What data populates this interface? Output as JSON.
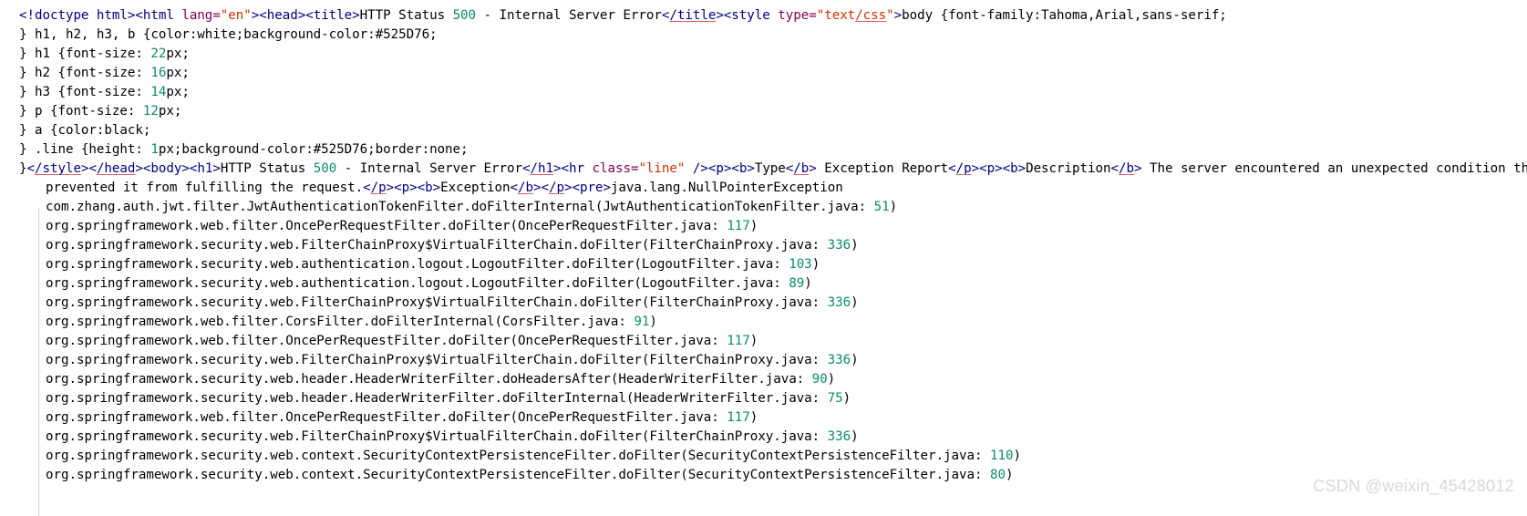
{
  "editor": {
    "language": "html",
    "colors": {
      "background": "#ffffff",
      "foreground": "#000000",
      "tag": "#000080",
      "attribute_name": "#7F0055",
      "attribute_value": "#CC3300",
      "number": "#0E8A6E",
      "indent_guide": "#CFCFCF",
      "spellcheck_underline": "#D06060",
      "watermark": "#D8D8D8"
    },
    "lines": [
      {
        "id": "line-1",
        "indent": 0,
        "tokens": [
          {
            "t": "tag",
            "v": "<!doctype html><html "
          },
          {
            "t": "attr",
            "v": "lang="
          },
          {
            "t": "attrval",
            "v": "\"en\""
          },
          {
            "t": "tag",
            "v": "><head><title>"
          },
          {
            "t": "plain",
            "v": "HTTP Status "
          },
          {
            "t": "num",
            "v": "500"
          },
          {
            "t": "plain",
            "v": " - Internal Server Error"
          },
          {
            "t": "tag",
            "v": "<",
            "u": false
          },
          {
            "t": "tag-u",
            "v": "/title"
          },
          {
            "t": "tag",
            "v": "><style "
          },
          {
            "t": "attr",
            "v": "type="
          },
          {
            "t": "attrval",
            "v": "\"text"
          },
          {
            "t": "attrval-u",
            "v": "/css"
          },
          {
            "t": "attrval",
            "v": "\""
          },
          {
            "t": "tag",
            "v": ">"
          },
          {
            "t": "plain",
            "v": "body {font-family:Tahoma,Arial,sans-serif;"
          }
        ]
      },
      {
        "id": "line-2",
        "indent": 0,
        "tokens": [
          {
            "t": "plain",
            "v": "} h1, h2, h3, b {color:white;background-color:#525D76;"
          }
        ]
      },
      {
        "id": "line-3",
        "indent": 0,
        "tokens": [
          {
            "t": "plain",
            "v": "} h1 {font-size: "
          },
          {
            "t": "num",
            "v": "22"
          },
          {
            "t": "plain",
            "v": "px;"
          }
        ]
      },
      {
        "id": "line-4",
        "indent": 0,
        "tokens": [
          {
            "t": "plain",
            "v": "} h2 {font-size: "
          },
          {
            "t": "num",
            "v": "16"
          },
          {
            "t": "plain",
            "v": "px;"
          }
        ]
      },
      {
        "id": "line-5",
        "indent": 0,
        "tokens": [
          {
            "t": "plain",
            "v": "} h3 {font-size: "
          },
          {
            "t": "num",
            "v": "14"
          },
          {
            "t": "plain",
            "v": "px;"
          }
        ]
      },
      {
        "id": "line-6",
        "indent": 0,
        "tokens": [
          {
            "t": "plain",
            "v": "} p {font-size: "
          },
          {
            "t": "num",
            "v": "12"
          },
          {
            "t": "plain",
            "v": "px;"
          }
        ]
      },
      {
        "id": "line-7",
        "indent": 0,
        "tokens": [
          {
            "t": "plain",
            "v": "} a {color:black;"
          }
        ]
      },
      {
        "id": "line-8",
        "indent": 0,
        "tokens": [
          {
            "t": "plain",
            "v": "} .line {height: "
          },
          {
            "t": "num",
            "v": "1"
          },
          {
            "t": "plain",
            "v": "px;background-color:#525D76;border:none;"
          }
        ]
      },
      {
        "id": "line-9",
        "indent": 0,
        "tokens": [
          {
            "t": "plain",
            "v": "}"
          },
          {
            "t": "tag",
            "v": "<"
          },
          {
            "t": "tag-u",
            "v": "/style"
          },
          {
            "t": "tag",
            "v": "><"
          },
          {
            "t": "tag-u",
            "v": "/head"
          },
          {
            "t": "tag",
            "v": "><body><h1>"
          },
          {
            "t": "plain",
            "v": "HTTP Status "
          },
          {
            "t": "num",
            "v": "500"
          },
          {
            "t": "plain",
            "v": " - Internal Server Error"
          },
          {
            "t": "tag",
            "v": "<"
          },
          {
            "t": "tag-u",
            "v": "/h1"
          },
          {
            "t": "tag",
            "v": "><hr "
          },
          {
            "t": "attr",
            "v": "class="
          },
          {
            "t": "attrval",
            "v": "\"line\""
          },
          {
            "t": "tag",
            "v": " /><p><b>"
          },
          {
            "t": "plain",
            "v": "Type"
          },
          {
            "t": "tag",
            "v": "<"
          },
          {
            "t": "tag-u",
            "v": "/b"
          },
          {
            "t": "tag",
            "v": ">"
          },
          {
            "t": "plain",
            "v": " Exception Report"
          },
          {
            "t": "tag",
            "v": "<"
          },
          {
            "t": "tag-u",
            "v": "/p"
          },
          {
            "t": "tag",
            "v": "><p><b>"
          },
          {
            "t": "plain",
            "v": "Description"
          },
          {
            "t": "tag",
            "v": "<"
          },
          {
            "t": "tag-u",
            "v": "/b"
          },
          {
            "t": "tag",
            "v": ">"
          },
          {
            "t": "plain",
            "v": " The server encountered an unexpected condition that"
          }
        ]
      },
      {
        "id": "line-10",
        "indent": 1,
        "tokens": [
          {
            "t": "plain",
            "v": "prevented it from fulfilling the request."
          },
          {
            "t": "tag",
            "v": "<"
          },
          {
            "t": "tag-u",
            "v": "/p"
          },
          {
            "t": "tag",
            "v": "><p><b>"
          },
          {
            "t": "plain",
            "v": "Exception"
          },
          {
            "t": "tag",
            "v": "<"
          },
          {
            "t": "tag-u",
            "v": "/b"
          },
          {
            "t": "tag",
            "v": "><"
          },
          {
            "t": "tag-u",
            "v": "/p"
          },
          {
            "t": "tag",
            "v": "><pre>"
          },
          {
            "t": "plain",
            "v": "java.lang.NullPointerException"
          }
        ]
      },
      {
        "id": "line-11",
        "indent": 2,
        "tokens": [
          {
            "t": "plain",
            "v": "com.zhang.auth.jwt.filter.JwtAuthenticationTokenFilter.doFilterInternal(JwtAuthenticationTokenFilter.java: "
          },
          {
            "t": "num",
            "v": "51"
          },
          {
            "t": "plain",
            "v": ")"
          }
        ]
      },
      {
        "id": "line-12",
        "indent": 2,
        "tokens": [
          {
            "t": "plain",
            "v": "org.springframework.web.filter.OncePerRequestFilter.doFilter(OncePerRequestFilter.java: "
          },
          {
            "t": "num",
            "v": "117"
          },
          {
            "t": "plain",
            "v": ")"
          }
        ]
      },
      {
        "id": "line-13",
        "indent": 2,
        "tokens": [
          {
            "t": "plain",
            "v": "org.springframework.security.web.FilterChainProxy$VirtualFilterChain.doFilter(FilterChainProxy.java: "
          },
          {
            "t": "num",
            "v": "336"
          },
          {
            "t": "plain",
            "v": ")"
          }
        ]
      },
      {
        "id": "line-14",
        "indent": 2,
        "tokens": [
          {
            "t": "plain",
            "v": "org.springframework.security.web.authentication.logout.LogoutFilter.doFilter(LogoutFilter.java: "
          },
          {
            "t": "num",
            "v": "103"
          },
          {
            "t": "plain",
            "v": ")"
          }
        ]
      },
      {
        "id": "line-15",
        "indent": 2,
        "tokens": [
          {
            "t": "plain",
            "v": "org.springframework.security.web.authentication.logout.LogoutFilter.doFilter(LogoutFilter.java: "
          },
          {
            "t": "num",
            "v": "89"
          },
          {
            "t": "plain",
            "v": ")"
          }
        ]
      },
      {
        "id": "line-16",
        "indent": 2,
        "tokens": [
          {
            "t": "plain",
            "v": "org.springframework.security.web.FilterChainProxy$VirtualFilterChain.doFilter(FilterChainProxy.java: "
          },
          {
            "t": "num",
            "v": "336"
          },
          {
            "t": "plain",
            "v": ")"
          }
        ]
      },
      {
        "id": "line-17",
        "indent": 2,
        "tokens": [
          {
            "t": "plain",
            "v": "org.springframework.web.filter.CorsFilter.doFilterInternal(CorsFilter.java: "
          },
          {
            "t": "num",
            "v": "91"
          },
          {
            "t": "plain",
            "v": ")"
          }
        ]
      },
      {
        "id": "line-18",
        "indent": 2,
        "tokens": [
          {
            "t": "plain",
            "v": "org.springframework.web.filter.OncePerRequestFilter.doFilter(OncePerRequestFilter.java: "
          },
          {
            "t": "num",
            "v": "117"
          },
          {
            "t": "plain",
            "v": ")"
          }
        ]
      },
      {
        "id": "line-19",
        "indent": 2,
        "tokens": [
          {
            "t": "plain",
            "v": "org.springframework.security.web.FilterChainProxy$VirtualFilterChain.doFilter(FilterChainProxy.java: "
          },
          {
            "t": "num",
            "v": "336"
          },
          {
            "t": "plain",
            "v": ")"
          }
        ]
      },
      {
        "id": "line-20",
        "indent": 2,
        "tokens": [
          {
            "t": "plain",
            "v": "org.springframework.security.web.header.HeaderWriterFilter.doHeadersAfter(HeaderWriterFilter.java: "
          },
          {
            "t": "num",
            "v": "90"
          },
          {
            "t": "plain",
            "v": ")"
          }
        ]
      },
      {
        "id": "line-21",
        "indent": 2,
        "tokens": [
          {
            "t": "plain",
            "v": "org.springframework.security.web.header.HeaderWriterFilter.doFilterInternal(HeaderWriterFilter.java: "
          },
          {
            "t": "num",
            "v": "75"
          },
          {
            "t": "plain",
            "v": ")"
          }
        ]
      },
      {
        "id": "line-22",
        "indent": 2,
        "tokens": [
          {
            "t": "plain",
            "v": "org.springframework.web.filter.OncePerRequestFilter.doFilter(OncePerRequestFilter.java: "
          },
          {
            "t": "num",
            "v": "117"
          },
          {
            "t": "plain",
            "v": ")"
          }
        ]
      },
      {
        "id": "line-23",
        "indent": 2,
        "tokens": [
          {
            "t": "plain",
            "v": "org.springframework.security.web.FilterChainProxy$VirtualFilterChain.doFilter(FilterChainProxy.java: "
          },
          {
            "t": "num",
            "v": "336"
          },
          {
            "t": "plain",
            "v": ")"
          }
        ]
      },
      {
        "id": "line-24",
        "indent": 2,
        "tokens": [
          {
            "t": "plain",
            "v": "org.springframework.security.web.context.SecurityContextPersistenceFilter.doFilter(SecurityContextPersistenceFilter.java: "
          },
          {
            "t": "num",
            "v": "110"
          },
          {
            "t": "plain",
            "v": ")"
          }
        ]
      },
      {
        "id": "line-25",
        "indent": 2,
        "tokens": [
          {
            "t": "plain",
            "v": "org.springframework.security.web.context.SecurityContextPersistenceFilter.doFilter(SecurityContextPersistenceFilter.java: "
          },
          {
            "t": "num",
            "v": "80"
          },
          {
            "t": "plain",
            "v": ")"
          }
        ]
      }
    ]
  },
  "watermark": {
    "text": "CSDN @weixin_45428012"
  }
}
